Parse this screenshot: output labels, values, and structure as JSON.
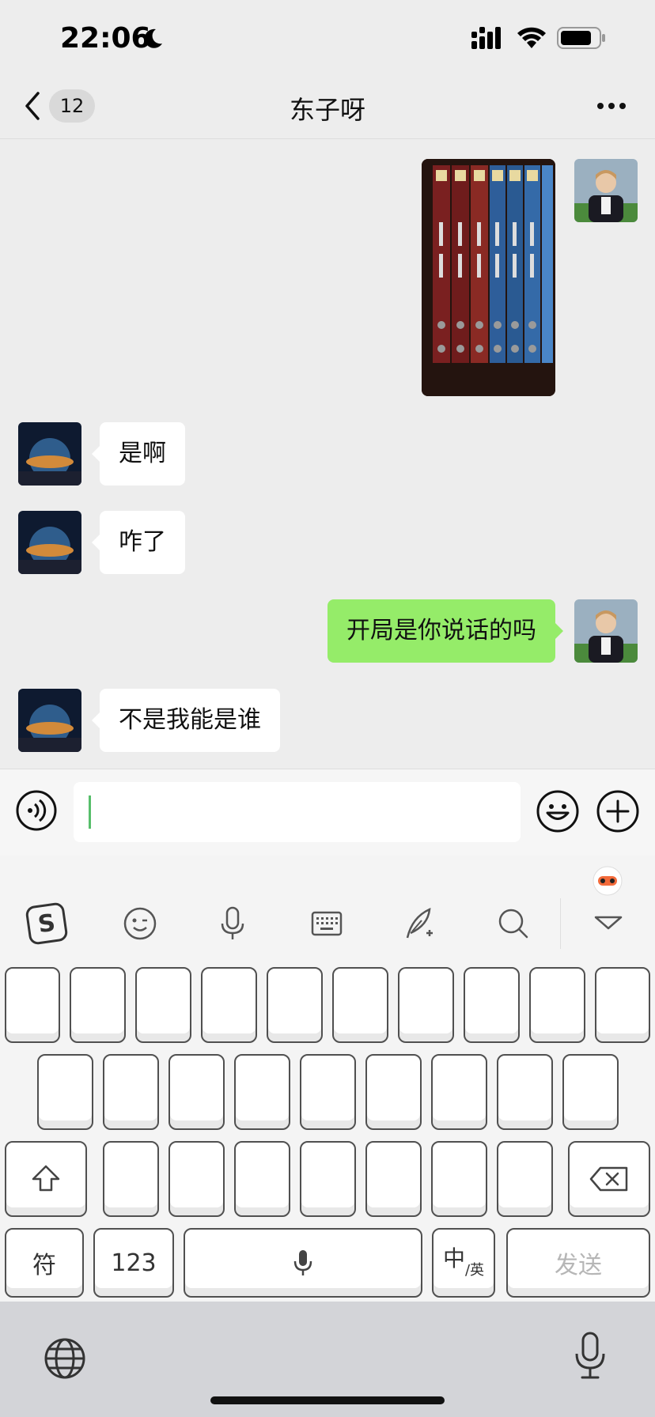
{
  "status_bar": {
    "time": "22:06"
  },
  "header": {
    "unread_count": "12",
    "title": "东子呀"
  },
  "messages": [
    {
      "from": "me",
      "kind": "image"
    },
    {
      "from": "them",
      "kind": "text",
      "text": "是啊"
    },
    {
      "from": "them",
      "kind": "text",
      "text": "咋了"
    },
    {
      "from": "me",
      "kind": "text",
      "text": "开局是你说话的吗"
    },
    {
      "from": "them",
      "kind": "text",
      "text": "不是我能是谁"
    }
  ],
  "input_bar": {
    "value": ""
  },
  "keyboard": {
    "symbols_key": "符",
    "numbers_key": "123",
    "lang_key_main": "中",
    "lang_key_sub": "/英",
    "send_key": "发送"
  },
  "icons": [
    "back-icon",
    "more-icon",
    "voice-icon",
    "emoji-icon",
    "plus-icon",
    "sogou-logo-icon",
    "smiley-icon",
    "mic-icon",
    "keyboard-icon",
    "quill-icon",
    "search-icon",
    "collapse-icon",
    "shift-icon",
    "delete-icon",
    "space-mic-icon",
    "globe-icon",
    "dictation-icon"
  ],
  "colors": {
    "sent_bubble": "#95ec69",
    "received_bubble": "#ffffff",
    "chat_bg": "#ededed"
  }
}
